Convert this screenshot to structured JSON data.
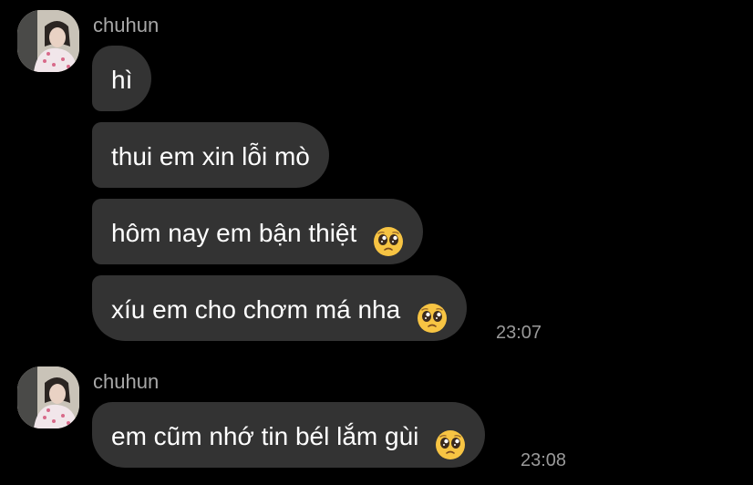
{
  "groups": [
    {
      "sender": "chuhun",
      "messages": [
        {
          "text": "hì",
          "emoji": null
        },
        {
          "text": "thui em xin lỗi mò",
          "emoji": null
        },
        {
          "text": "hôm nay em bận thiệt",
          "emoji": "pleading-face-icon"
        },
        {
          "text": "xíu em cho chơm má nha",
          "emoji": "pleading-face-icon"
        }
      ],
      "time": "23:07"
    },
    {
      "sender": "chuhun",
      "messages": [
        {
          "text": "em cũm nhớ tin bél lắm gùi",
          "emoji": "pleading-face-icon"
        }
      ],
      "time": "23:08"
    }
  ],
  "colors": {
    "background": "#000000",
    "bubble": "#333333",
    "text": "#ffffff",
    "meta": "#a8a8a8"
  }
}
